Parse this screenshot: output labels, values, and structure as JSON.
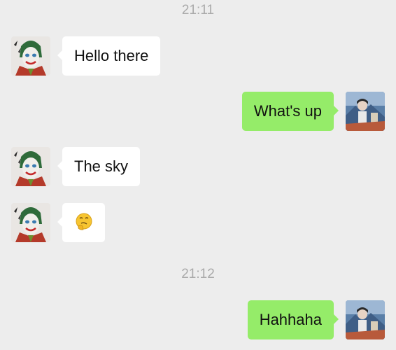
{
  "chat": {
    "timestamps": [
      "21:11",
      "21:12"
    ],
    "messages": [
      {
        "sender": "contact",
        "text": "Hello there"
      },
      {
        "sender": "me",
        "text": "What's up"
      },
      {
        "sender": "contact",
        "text": "The sky"
      },
      {
        "sender": "contact",
        "emoji": "thinking-face-emoji"
      },
      {
        "sender": "me",
        "text": "Hahhaha"
      }
    ]
  },
  "colors": {
    "background": "#ededed",
    "incoming_bubble": "#ffffff",
    "outgoing_bubble": "#95ec69",
    "timestamp_text": "#aaaaaa"
  },
  "avatars": {
    "contact": "joker-portrait-avatar",
    "me": "user-photo-avatar"
  }
}
